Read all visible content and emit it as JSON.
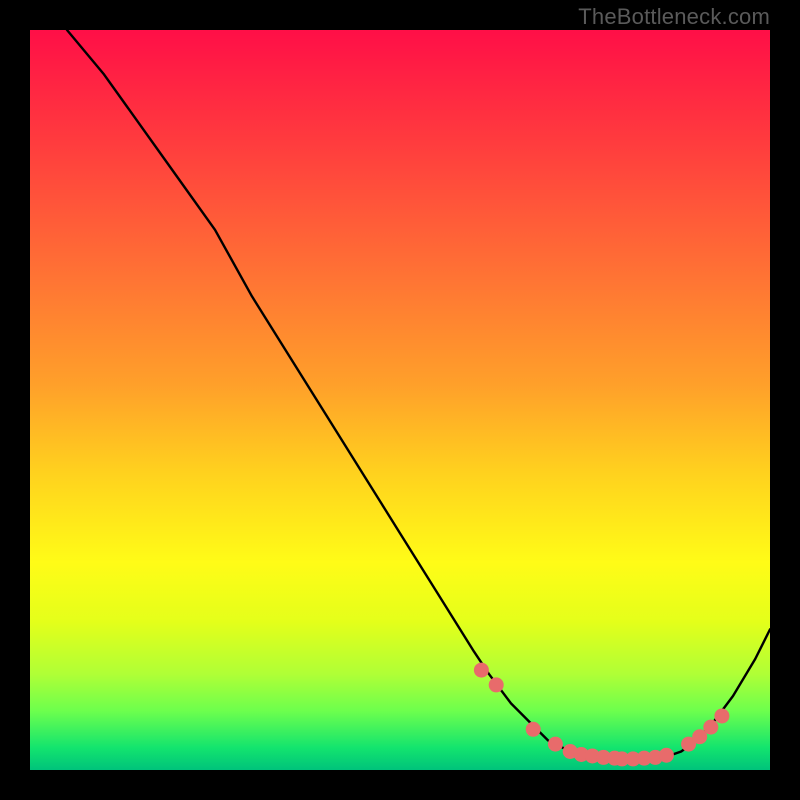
{
  "watermark": "TheBottleneck.com",
  "chart_data": {
    "type": "line",
    "title": "",
    "xlabel": "",
    "ylabel": "",
    "xlim": [
      0,
      100
    ],
    "ylim": [
      0,
      100
    ],
    "grid": false,
    "legend": false,
    "series": [
      {
        "name": "curve",
        "color": "#000000",
        "x": [
          5,
          10,
          15,
          20,
          25,
          30,
          35,
          40,
          45,
          50,
          55,
          60,
          62,
          65,
          68,
          70,
          72,
          74,
          76,
          78,
          80,
          82,
          84,
          86,
          88,
          90,
          92,
          95,
          98,
          100
        ],
        "y": [
          100,
          94,
          87,
          80,
          73,
          64,
          56,
          48,
          40,
          32,
          24,
          16,
          13,
          9,
          6,
          4,
          3,
          2.2,
          1.8,
          1.5,
          1.3,
          1.3,
          1.4,
          1.8,
          2.5,
          4,
          6,
          10,
          15,
          19
        ]
      },
      {
        "name": "dots",
        "color": "#e86b6b",
        "marker": "circle",
        "x": [
          61,
          63,
          68,
          71,
          73,
          74.5,
          76,
          77.5,
          79,
          80,
          81.5,
          83,
          84.5,
          86,
          89,
          90.5,
          92,
          93.5
        ],
        "y": [
          13.5,
          11.5,
          5.5,
          3.5,
          2.5,
          2.1,
          1.9,
          1.7,
          1.6,
          1.5,
          1.5,
          1.6,
          1.7,
          2.0,
          3.5,
          4.5,
          5.8,
          7.3
        ]
      }
    ]
  }
}
